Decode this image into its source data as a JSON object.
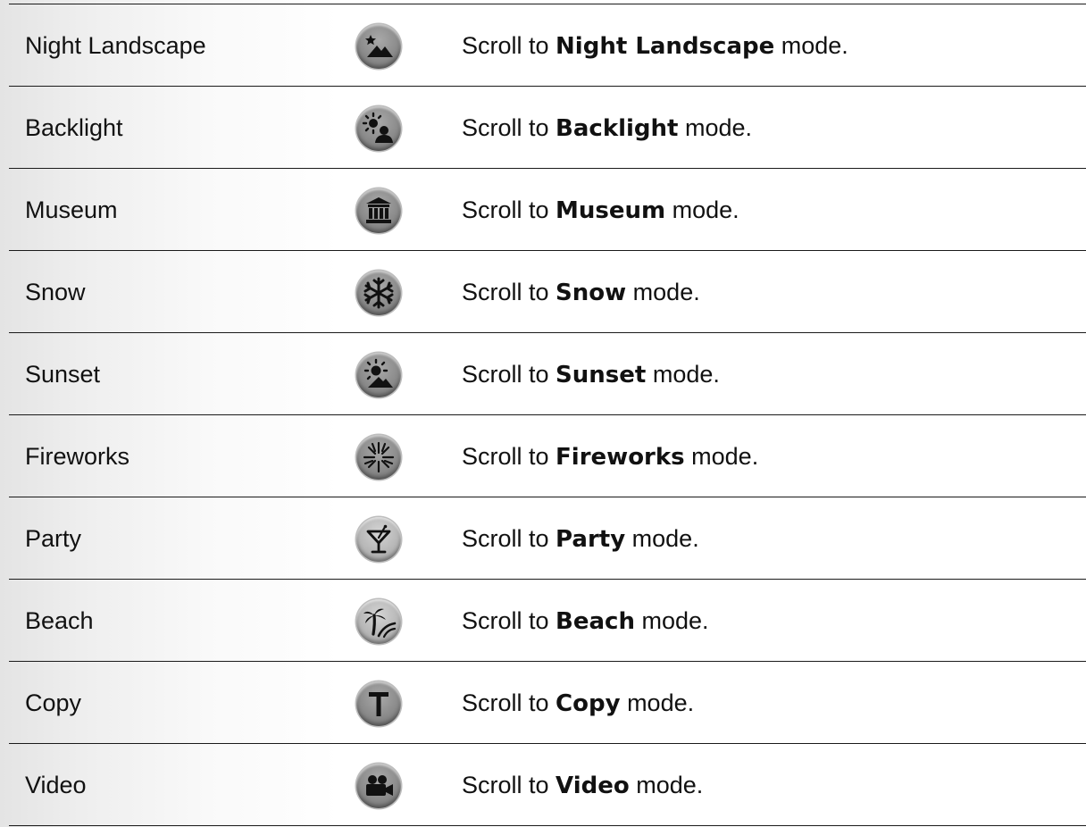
{
  "rows": [
    {
      "name": "Night Landscape",
      "icon": "night-landscape-icon",
      "prefix": "Scroll to ",
      "mode": "Night Landscape",
      "suffix": " mode."
    },
    {
      "name": "Backlight",
      "icon": "backlight-icon",
      "prefix": "Scroll to ",
      "mode": "Backlight",
      "suffix": " mode."
    },
    {
      "name": "Museum",
      "icon": "museum-icon",
      "prefix": "Scroll to ",
      "mode": "Museum",
      "suffix": " mode."
    },
    {
      "name": "Snow",
      "icon": "snowflake-icon",
      "prefix": "Scroll to ",
      "mode": "Snow",
      "suffix": " mode."
    },
    {
      "name": "Sunset",
      "icon": "sunset-icon",
      "prefix": "Scroll to ",
      "mode": "Sunset",
      "suffix": " mode."
    },
    {
      "name": "Fireworks",
      "icon": "fireworks-icon",
      "prefix": "Scroll to ",
      "mode": "Fireworks",
      "suffix": " mode."
    },
    {
      "name": "Party",
      "icon": "cocktail-glass-icon",
      "prefix": "Scroll to ",
      "mode": "Party",
      "suffix": " mode."
    },
    {
      "name": "Beach",
      "icon": "palm-tree-beach-icon",
      "prefix": "Scroll to ",
      "mode": "Beach",
      "suffix": " mode."
    },
    {
      "name": "Copy",
      "icon": "text-copy-icon",
      "prefix": "Scroll to ",
      "mode": "Copy",
      "suffix": " mode."
    },
    {
      "name": "Video",
      "icon": "video-camera-icon",
      "prefix": "Scroll to ",
      "mode": "Video",
      "suffix": " mode."
    }
  ]
}
